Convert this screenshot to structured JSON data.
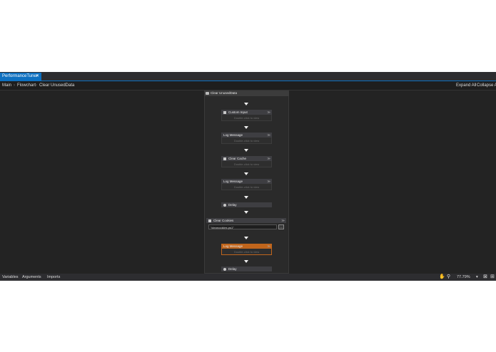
{
  "tab": {
    "title": "PerformanceTuner",
    "close": "✕"
  },
  "breadcrumb": {
    "items": [
      "Main",
      "Flowchart",
      "Clear UnusedData"
    ],
    "separator": "›"
  },
  "toolbar": {
    "expand_all": "Expand All",
    "collapse_all": "Collapse All"
  },
  "sequence": {
    "title": "Clear UnusedData"
  },
  "activities": [
    {
      "title": "Custom Input",
      "hint": "Double-click to view",
      "icon": "input-icon"
    },
    {
      "title": "Log Message",
      "hint": "Double-click to view",
      "icon": "log-icon"
    },
    {
      "title": "Clear Cache",
      "hint": "Double-click to view",
      "icon": "cache-icon"
    },
    {
      "title": "Log Message",
      "hint": "Double-click to view",
      "icon": "log-icon"
    },
    {
      "title": "Delay",
      "icon": "clock-icon"
    },
    {
      "title": "Log Message",
      "hint": "Double-click to view",
      "icon": "log-icon",
      "selected": true
    },
    {
      "title": "Delay",
      "icon": "clock-icon"
    }
  ],
  "clear_cookies": {
    "title": "Clear Cookies",
    "script_value": "\"clearcookies.ps1\"",
    "browse_label": "..."
  },
  "status_bar": {
    "tabs": [
      "Variables",
      "Arguments",
      "Imports"
    ],
    "zoom": "77.79%",
    "zoom_dropdown": "▾"
  },
  "colors": {
    "accent": "#0e70c0",
    "selected": "#c0651c",
    "background": "#252525"
  }
}
